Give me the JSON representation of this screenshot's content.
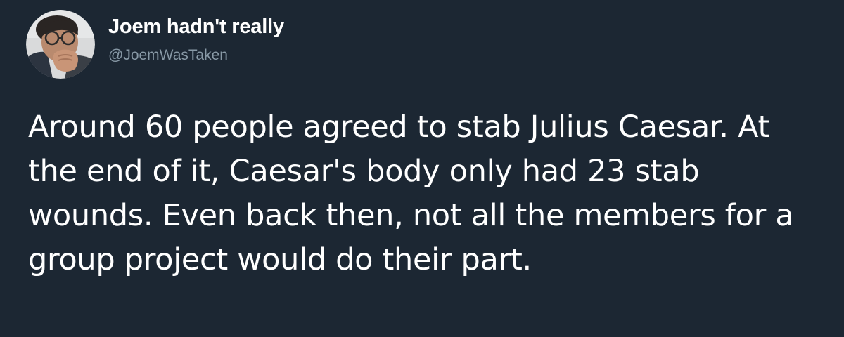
{
  "author": {
    "display_name": "Joem hadn't really",
    "handle": "@JoemWasTaken",
    "avatar_icon": "profile-photo-avatar"
  },
  "tweet": {
    "text": "Around 60 people agreed to stab Julius Caesar. At the end of it, Caesar's body only had 23 stab wounds. Even back then, not all the members for a group project would do their part."
  },
  "colors": {
    "background": "#1c2733",
    "text": "#ffffff",
    "handle": "#8899a6"
  }
}
